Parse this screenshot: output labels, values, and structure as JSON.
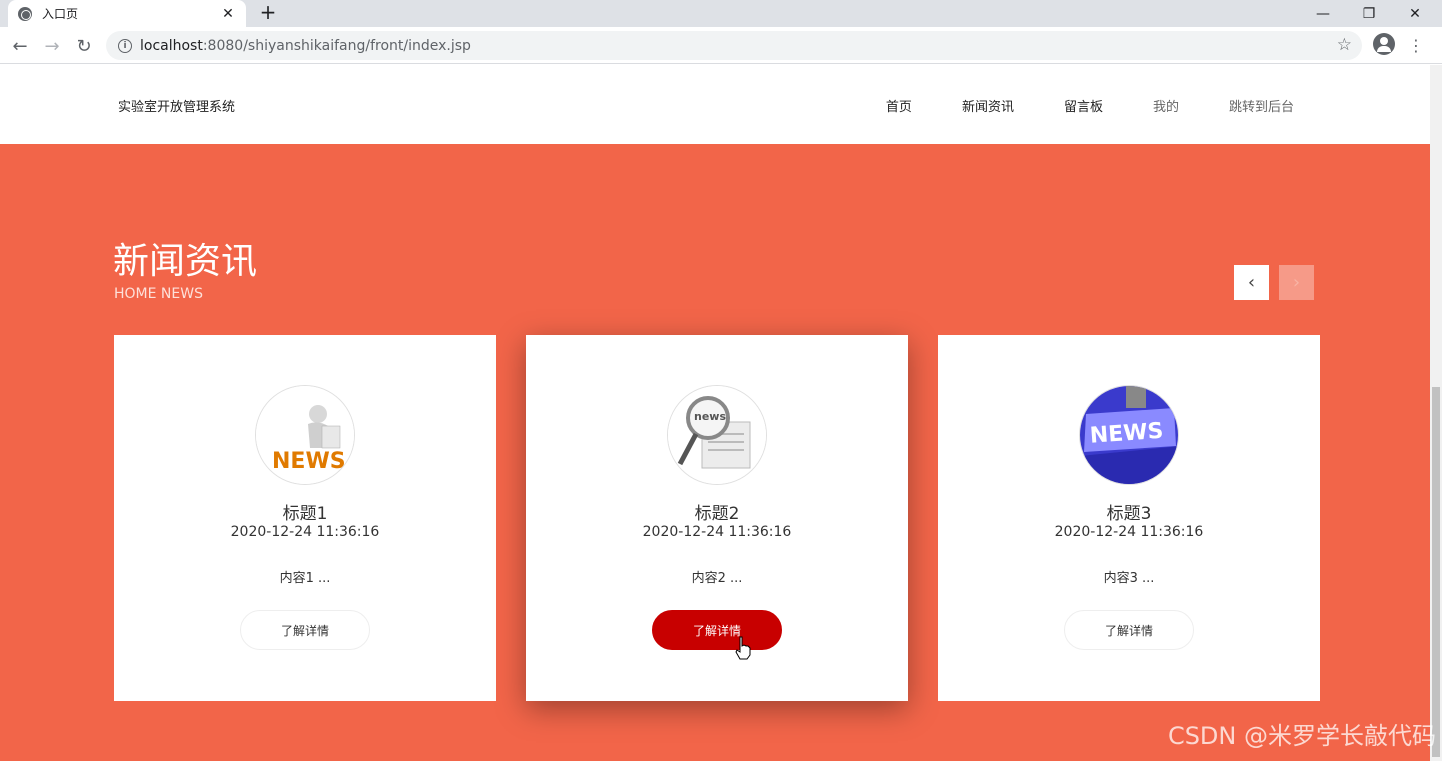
{
  "browser": {
    "tab_title": "入口页",
    "tab_close": "✕",
    "new_tab": "+",
    "url_host": "localhost",
    "url_path": ":8080/shiyanshikaifang/front/index.jsp",
    "minimize": "—",
    "restore": "❐",
    "close": "✕",
    "back": "←",
    "forward": "→",
    "reload": "↻",
    "info": "i",
    "star": "☆",
    "menu": "⋮"
  },
  "site": {
    "title": "实验室开放管理系统",
    "nav": [
      "首页",
      "新闻资讯",
      "留言板",
      "我的",
      "跳转到后台"
    ]
  },
  "section": {
    "title": "新闻资讯",
    "subtitle": "HOME NEWS",
    "prev": "‹",
    "next": "›"
  },
  "cards": [
    {
      "title": "标题1",
      "time": "2020-12-24 11:36:16",
      "content": "内容1 ...",
      "button": "了解详情"
    },
    {
      "title": "标题2",
      "time": "2020-12-24 11:36:16",
      "content": "内容2 ...",
      "button": "了解详情"
    },
    {
      "title": "标题3",
      "time": "2020-12-24 11:36:16",
      "content": "内容3 ...",
      "button": "了解详情"
    }
  ],
  "watermark": "CSDN @米罗学长敲代码",
  "colors": {
    "accent": "#f26549",
    "button_active": "#c80000"
  }
}
